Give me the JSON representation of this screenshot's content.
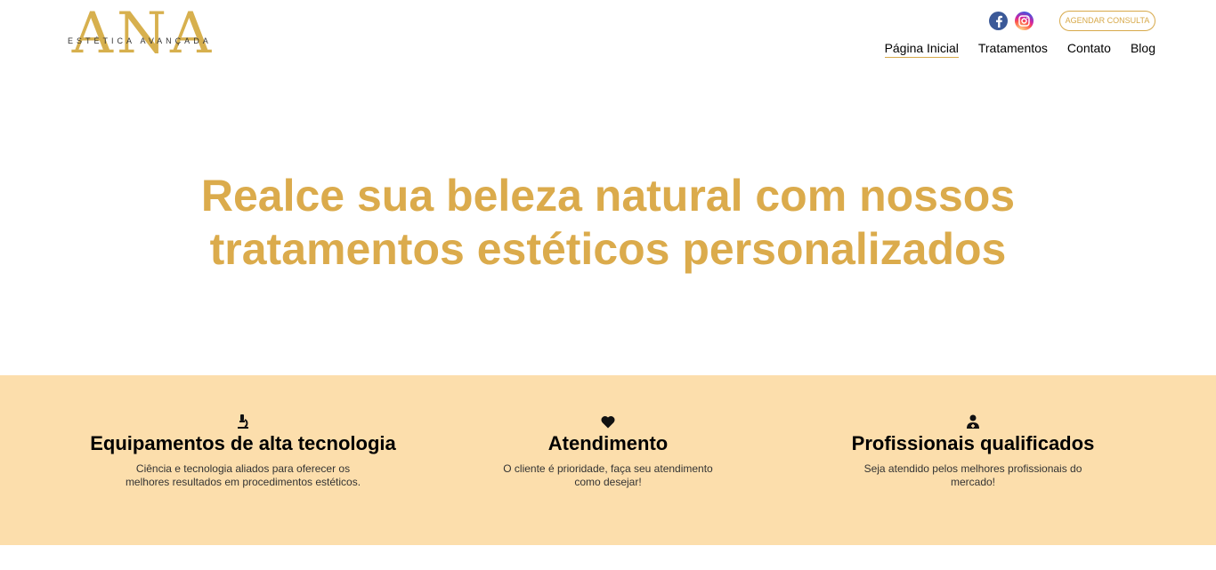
{
  "header": {
    "logo": {
      "mark": "ANA",
      "tagline": "ESTÉTICA AVANÇADA"
    },
    "social": [
      {
        "name": "facebook-icon",
        "color": "#3b5998"
      },
      {
        "name": "instagram-icon",
        "color": "#d6249f"
      }
    ],
    "cta_label": "AGENDAR CONSULTA",
    "nav": [
      {
        "label": "Página Inicial",
        "active": true
      },
      {
        "label": "Tratamentos",
        "active": false
      },
      {
        "label": "Contato",
        "active": false
      },
      {
        "label": "Blog",
        "active": false
      }
    ]
  },
  "hero": {
    "title_line1": "Realce sua beleza natural com nossos",
    "title_line2": "tratamentos estéticos personalizados"
  },
  "features": [
    {
      "icon": "microscope-icon",
      "title": "Equipamentos de alta tecnologia",
      "text": "Ciência e tecnologia aliados para oferecer os melhores resultados em procedimentos estéticos."
    },
    {
      "icon": "heart-icon",
      "title": "Atendimento",
      "text": "O cliente é prioridade, faça seu atendimento como desejar!"
    },
    {
      "icon": "doctor-icon",
      "title": "Profissionais qualificados",
      "text": "Seja atendido pelos melhores profissionais do mercado!"
    }
  ],
  "colors": {
    "gold": "#dbab4c",
    "band": "#fcdeac",
    "facebook": "#3b5998"
  }
}
